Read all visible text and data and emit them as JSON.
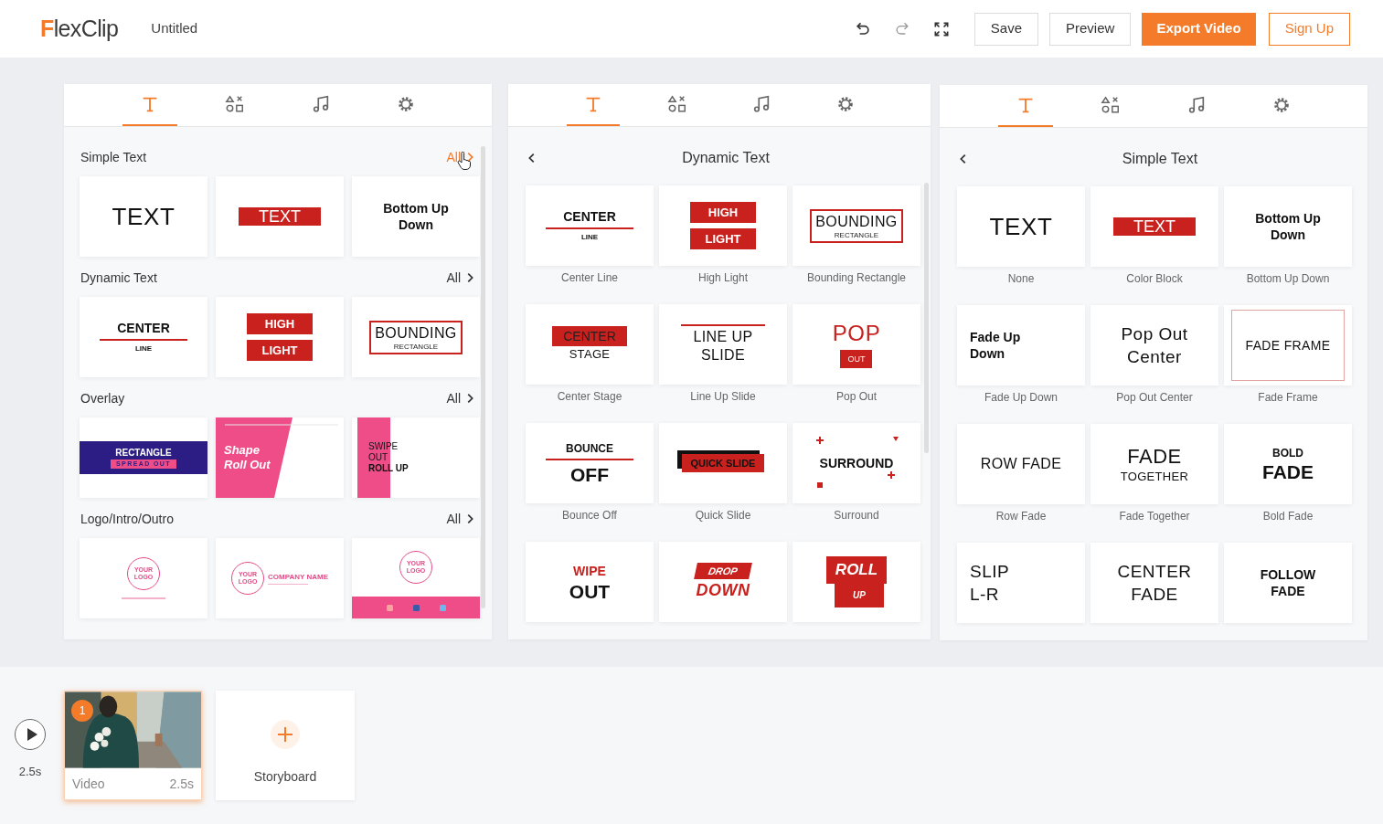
{
  "header": {
    "logo": "FlexClip",
    "title": "Untitled",
    "tools": [
      {
        "kind": "undo"
      },
      {
        "kind": "redo"
      },
      {
        "kind": "fullscreen"
      }
    ],
    "buttons": [
      {
        "label": "Save",
        "kind": "outline"
      },
      {
        "label": "Preview",
        "kind": "outline"
      },
      {
        "label": "Export Video",
        "kind": "primary"
      },
      {
        "label": "Sign Up",
        "kind": "accent"
      }
    ]
  },
  "panels": [
    {
      "kind": "sections",
      "tabs": [
        {
          "kind": "text",
          "selected": true
        },
        {
          "kind": "shapes",
          "selected": false
        },
        {
          "kind": "music",
          "selected": false
        },
        {
          "kind": "settings",
          "selected": false
        }
      ],
      "sections": [
        {
          "title": "Simple Text",
          "link": "All",
          "hovered": true,
          "cards": [
            {
              "kind": "plain",
              "lines": [
                {
                  "text": "TEXT",
                  "kind": "big"
                }
              ]
            },
            {
              "kind": "plain",
              "lines": [
                {
                  "text": "TEXT",
                  "kind": "block"
                }
              ]
            },
            {
              "kind": "plain",
              "lines": [
                {
                  "text": "Bottom Up",
                  "kind": "heavy"
                },
                {
                  "text": "Down",
                  "kind": "heavy"
                }
              ]
            }
          ]
        },
        {
          "title": "Dynamic Text",
          "link": "All",
          "hovered": false,
          "cards": [
            {
              "kind": "underline",
              "lines": [
                {
                  "text": "CENTER",
                  "kind": "heavy"
                },
                {
                  "text": "LINE",
                  "kind": "tiny"
                }
              ]
            },
            {
              "kind": "plain",
              "lines": [
                {
                  "text": "HIGH",
                  "kind": "blockbold"
                },
                {
                  "text": "LIGHT",
                  "kind": "blockbold"
                }
              ]
            },
            {
              "kind": "frame",
              "lines": [
                {
                  "text": "BOUNDING",
                  "kind": "plain"
                },
                {
                  "text": "RECTANGLE",
                  "kind": "tinyplain"
                }
              ]
            }
          ]
        },
        {
          "title": "Overlay",
          "link": "All",
          "hovered": false,
          "cards": [
            {
              "kind": "band",
              "lines": [
                {
                  "text": "RECTANGLE",
                  "kind": "bandtitle"
                },
                {
                  "text": "SPREAD OUT",
                  "kind": "bandsub"
                }
              ]
            },
            {
              "kind": "slant",
              "lines": [
                {
                  "text": "Shape",
                  "kind": "slant"
                },
                {
                  "text": "Roll Out",
                  "kind": "slant"
                }
              ]
            },
            {
              "kind": "swipe",
              "lines": [
                {
                  "text": "SWIPE",
                  "kind": "swipe"
                },
                {
                  "text": "OUT",
                  "kind": "swipe"
                },
                {
                  "text": "ROLL UP",
                  "kind": "swipebold"
                }
              ]
            }
          ]
        },
        {
          "title": "Logo/Intro/Outro",
          "link": "All",
          "hovered": false,
          "cards": [
            {
              "kind": "logocenter",
              "lines": [
                {
                  "text": "YOUR LOGO",
                  "kind": "logo"
                }
              ]
            },
            {
              "kind": "logorow",
              "lines": [
                {
                  "text": "YOUR LOGO",
                  "kind": "logo"
                },
                {
                  "text": "COMPANY NAME",
                  "kind": "company"
                }
              ]
            },
            {
              "kind": "logobar",
              "lines": [
                {
                  "text": "YOUR LOGO",
                  "kind": "logo"
                }
              ]
            }
          ]
        }
      ]
    },
    {
      "kind": "gallery",
      "title": "Dynamic Text",
      "tabs": [
        {
          "kind": "text",
          "selected": true
        },
        {
          "kind": "shapes",
          "selected": false
        },
        {
          "kind": "music",
          "selected": false
        },
        {
          "kind": "settings",
          "selected": false
        }
      ],
      "cards": [
        {
          "caption": "Center Line",
          "kind": "underline",
          "lines": [
            {
              "text": "CENTER",
              "kind": "heavy"
            },
            {
              "text": "LINE",
              "kind": "tiny"
            }
          ]
        },
        {
          "caption": "High Light",
          "kind": "plain",
          "lines": [
            {
              "text": "HIGH",
              "kind": "blockbold"
            },
            {
              "text": "LIGHT",
              "kind": "blockbold"
            }
          ]
        },
        {
          "caption": "Bounding Rectangle",
          "kind": "frame",
          "lines": [
            {
              "text": "BOUNDING",
              "kind": "plain"
            },
            {
              "text": "RECTANGLE",
              "kind": "tinyplain"
            }
          ]
        },
        {
          "caption": "Center Stage",
          "kind": "plain",
          "lines": [
            {
              "text": "CENTER",
              "kind": "blockdark"
            },
            {
              "text": "STAGE",
              "kind": "small"
            }
          ]
        },
        {
          "caption": "Line Up Slide",
          "kind": "overline",
          "lines": [
            {
              "text": "LINE UP",
              "kind": "plain"
            },
            {
              "text": "SLIDE",
              "kind": "plain"
            }
          ]
        },
        {
          "caption": "Pop Out",
          "kind": "plain",
          "lines": [
            {
              "text": "POP",
              "kind": "redlg"
            },
            {
              "text": "OUT",
              "kind": "tinyblock"
            }
          ]
        },
        {
          "caption": "Bounce Off",
          "kind": "underline",
          "lines": [
            {
              "text": "BOUNCE",
              "kind": "heavysm"
            },
            {
              "text": "OFF",
              "kind": "heavylg"
            }
          ]
        },
        {
          "caption": "Quick Slide",
          "kind": "plain",
          "lines": [
            {
              "text": "QUICK SLIDE",
              "kind": "shadowblock"
            }
          ]
        },
        {
          "caption": "Surround",
          "kind": "sparkles",
          "lines": [
            {
              "text": "SURROUND",
              "kind": "heavy"
            }
          ]
        },
        {
          "kind": "plain",
          "lines": [
            {
              "text": "WIPE",
              "kind": "redbold"
            },
            {
              "text": "OUT",
              "kind": "heavylg"
            }
          ]
        },
        {
          "kind": "plain",
          "lines": [
            {
              "text": "DROP",
              "kind": "italicblock"
            },
            {
              "text": "DOWN",
              "kind": "italicred"
            }
          ]
        },
        {
          "kind": "plain",
          "lines": [
            {
              "text": "ROLL",
              "kind": "rolltop"
            },
            {
              "text": "UP",
              "kind": "rollbottom"
            }
          ]
        }
      ]
    },
    {
      "kind": "gallery",
      "title": "Simple Text",
      "tabs": [
        {
          "kind": "text",
          "selected": true
        },
        {
          "kind": "shapes",
          "selected": false
        },
        {
          "kind": "music",
          "selected": false
        },
        {
          "kind": "settings",
          "selected": false
        }
      ],
      "cards": [
        {
          "caption": "None",
          "kind": "plain",
          "lines": [
            {
              "text": "TEXT",
              "kind": "big"
            }
          ]
        },
        {
          "caption": "Color Block",
          "kind": "plain",
          "lines": [
            {
              "text": "TEXT",
              "kind": "block"
            }
          ]
        },
        {
          "caption": "Bottom Up Down",
          "kind": "plain",
          "lines": [
            {
              "text": "Bottom Up",
              "kind": "heavy"
            },
            {
              "text": "Down",
              "kind": "heavy"
            }
          ]
        },
        {
          "caption": "Fade Up Down",
          "kind": "left",
          "lines": [
            {
              "text": "Fade Up",
              "kind": "heavy"
            },
            {
              "text": "Down",
              "kind": "heavy"
            }
          ]
        },
        {
          "caption": "Pop Out Center",
          "kind": "plain",
          "lines": [
            {
              "text": "Pop Out",
              "kind": "plainlg"
            },
            {
              "text": "Center",
              "kind": "plainlg"
            }
          ]
        },
        {
          "caption": "Fade Frame",
          "kind": "softframe",
          "lines": [
            {
              "text": "FADE FRAME",
              "kind": "plainsm"
            }
          ]
        },
        {
          "caption": "Row Fade",
          "kind": "plain",
          "lines": [
            {
              "text": "ROW FADE",
              "kind": "plain"
            }
          ]
        },
        {
          "caption": "Fade Together",
          "kind": "plain",
          "lines": [
            {
              "text": "FADE",
              "kind": "plainxl"
            },
            {
              "text": "TOGETHER",
              "kind": "small"
            }
          ]
        },
        {
          "caption": "Bold Fade",
          "kind": "plain",
          "lines": [
            {
              "text": "BOLD",
              "kind": "heavysm"
            },
            {
              "text": "FADE",
              "kind": "heavylg"
            }
          ]
        },
        {
          "kind": "left",
          "lines": [
            {
              "text": "SLIP",
              "kind": "plainlg"
            },
            {
              "text": "L-R",
              "kind": "plainlg"
            }
          ]
        },
        {
          "kind": "plain",
          "lines": [
            {
              "text": "CENTER",
              "kind": "plainlg"
            },
            {
              "text": "FADE",
              "kind": "plainlg"
            }
          ]
        },
        {
          "kind": "plain",
          "lines": [
            {
              "text": "FOLLOW",
              "kind": "heavy"
            },
            {
              "text": "FADE",
              "kind": "heavy"
            }
          ]
        }
      ]
    }
  ],
  "timeline": {
    "total": "2.5s",
    "clips": [
      {
        "label": "Video",
        "duration": "2.5s",
        "badge": "1",
        "selected": true
      }
    ],
    "add": {
      "label": "Storyboard"
    }
  }
}
